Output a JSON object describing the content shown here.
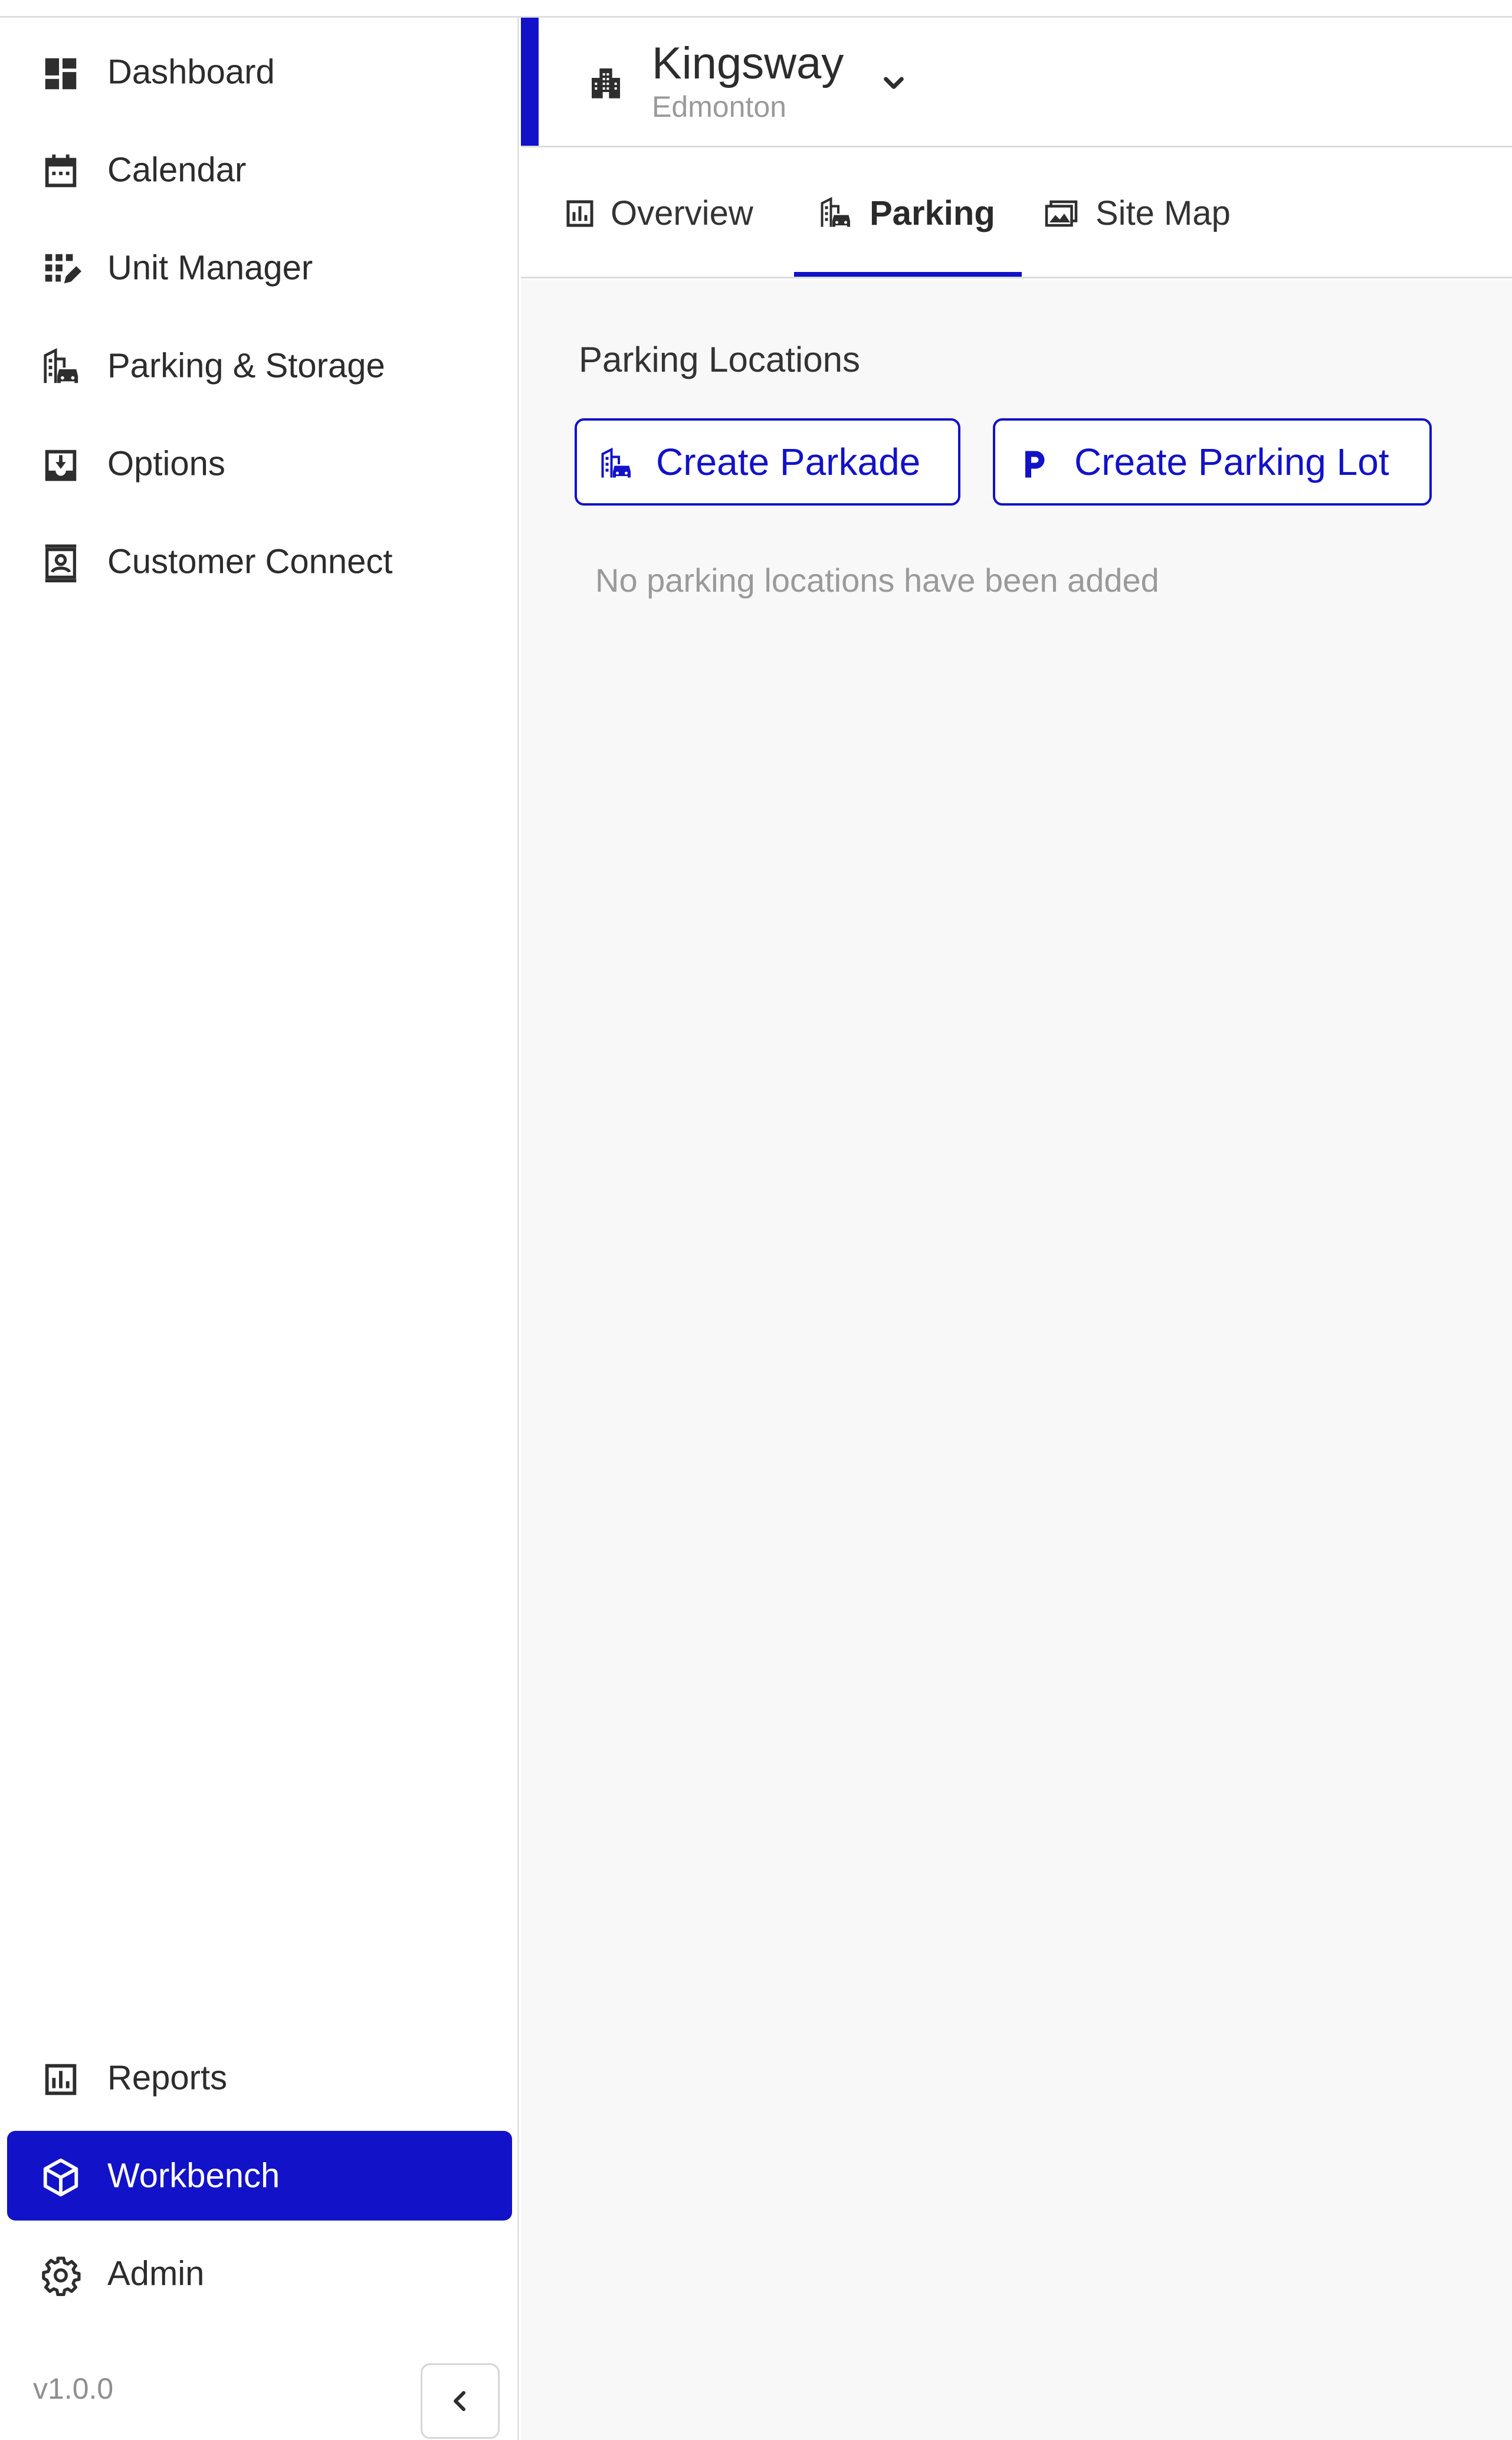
{
  "sidebar": {
    "items": [
      {
        "label": "Dashboard",
        "icon": "dashboard-icon"
      },
      {
        "label": "Calendar",
        "icon": "calendar-icon"
      },
      {
        "label": "Unit Manager",
        "icon": "unit-manager-icon"
      },
      {
        "label": "Parking & Storage",
        "icon": "parking-storage-icon"
      },
      {
        "label": "Options",
        "icon": "options-icon"
      },
      {
        "label": "Customer Connect",
        "icon": "customer-connect-icon"
      }
    ],
    "bottom_items": [
      {
        "label": "Reports",
        "icon": "reports-icon"
      },
      {
        "label": "Workbench",
        "icon": "workbench-icon",
        "active": true
      },
      {
        "label": "Admin",
        "icon": "gear-icon"
      }
    ],
    "version": "v1.0.0",
    "collapse_icon": "chevron-left-icon"
  },
  "header": {
    "title": "Kingsway",
    "subtitle": "Edmonton",
    "icon": "building-icon",
    "dropdown_icon": "chevron-down-icon"
  },
  "tabs": [
    {
      "label": "Overview",
      "icon": "chart-icon"
    },
    {
      "label": "Parking",
      "icon": "parking-icon",
      "active": true
    },
    {
      "label": "Site Map",
      "icon": "image-icon"
    }
  ],
  "main": {
    "section_title": "Parking Locations",
    "buttons": {
      "create_parkade": "Create Parkade",
      "create_parking_lot": "Create Parking Lot"
    },
    "empty_message": "No parking locations have been added"
  },
  "colors": {
    "accent": "#1212c8",
    "text": "#2c2c2c",
    "muted": "#9a9a9a",
    "content_bg": "#f8f8f8"
  }
}
